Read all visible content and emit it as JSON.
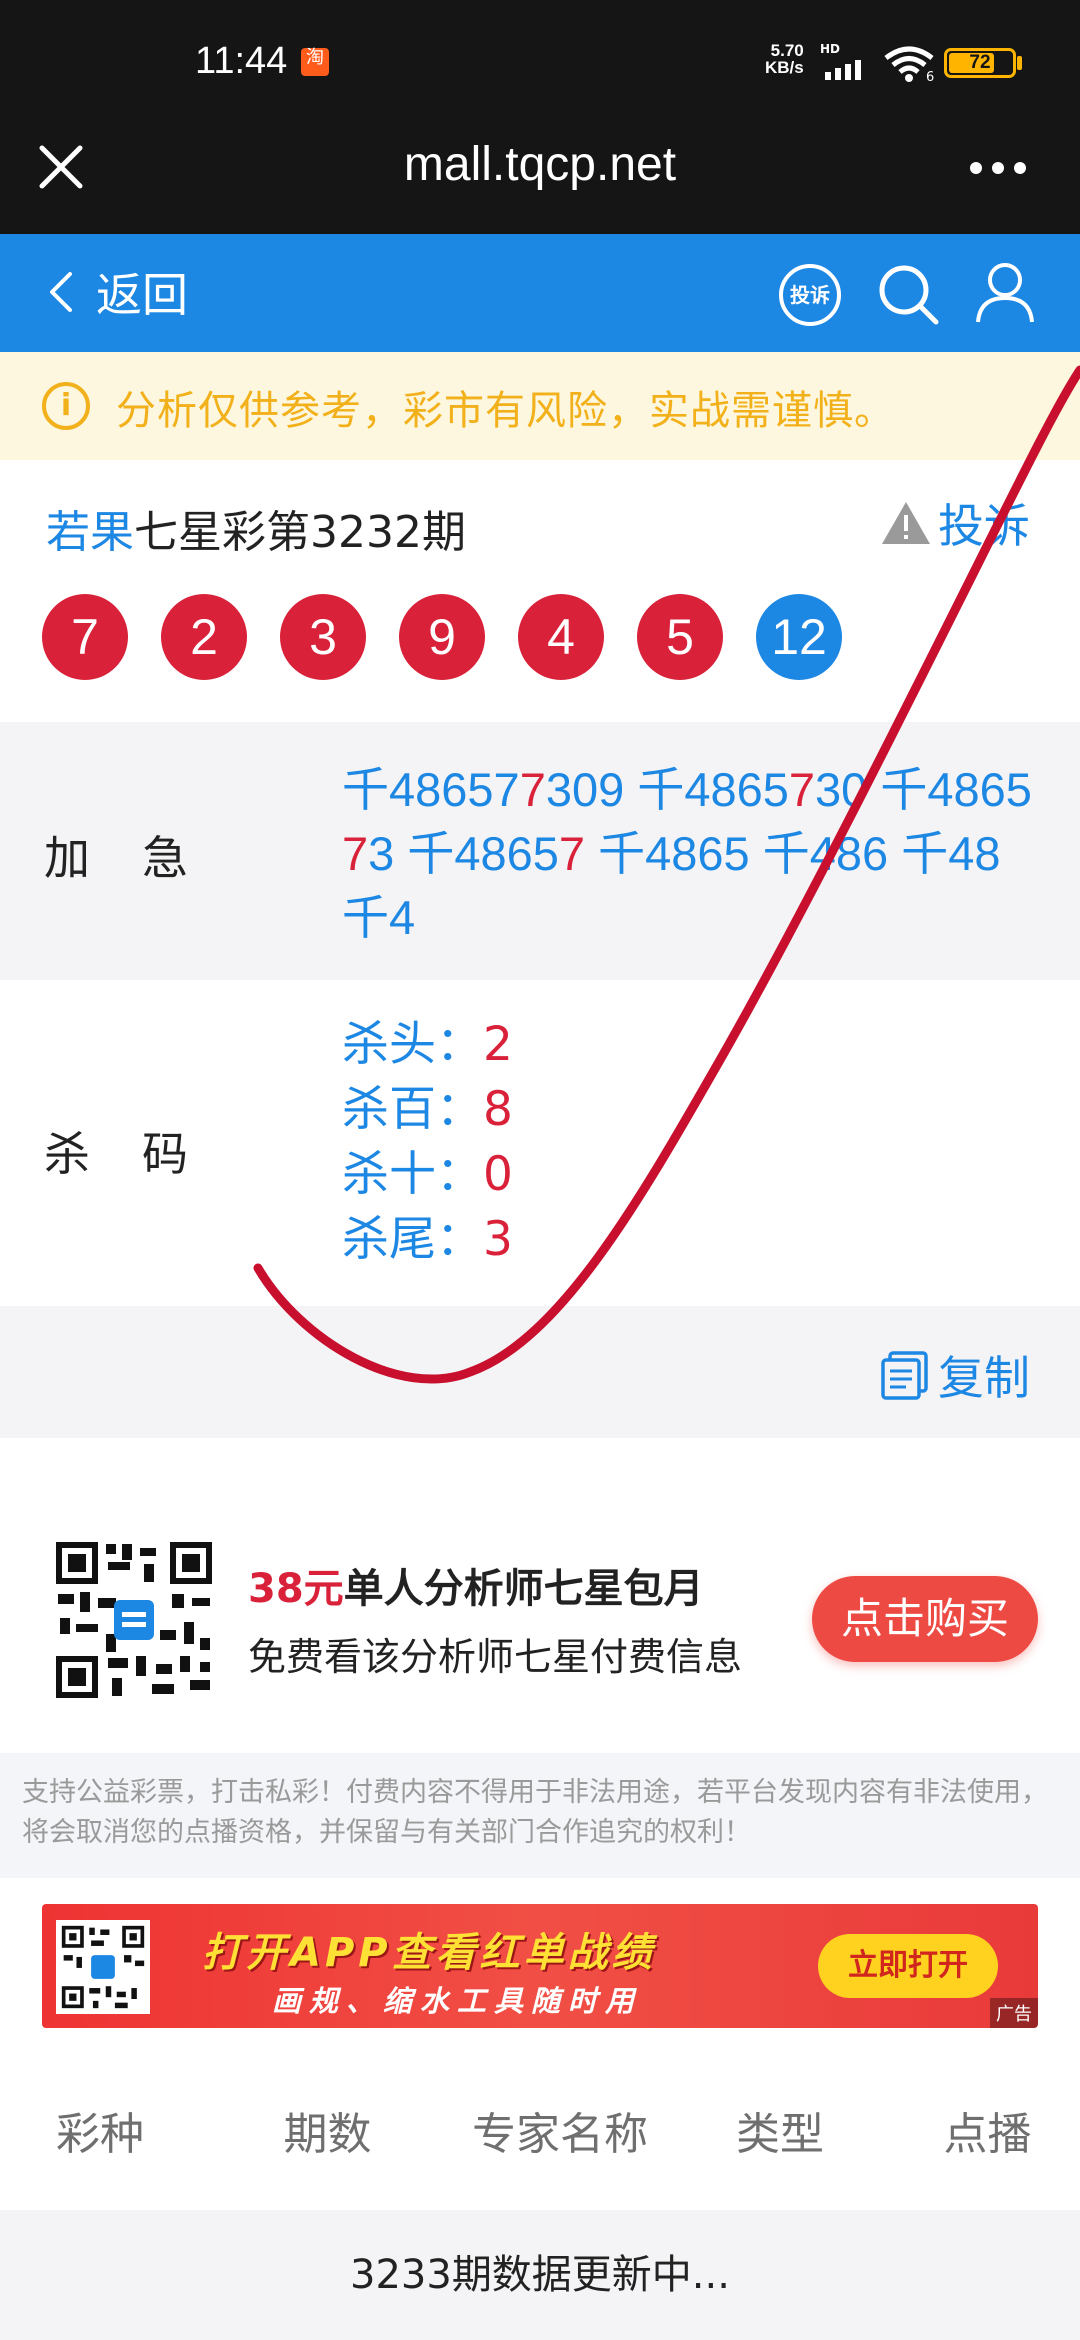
{
  "status_bar": {
    "time": "11:44",
    "notification_badge": "淘",
    "net_speed_value": "5.70",
    "net_speed_unit": "KB/s",
    "hd_label": "HD",
    "wifi_label": "6",
    "battery": "72",
    "battery_level": 0.72
  },
  "browser": {
    "url": "mall.tqcp.net"
  },
  "nav": {
    "back_label": "返回",
    "complain_label": "投诉"
  },
  "notice": {
    "icon": "i",
    "text": "分析仅供参考，彩市有风险，实战需谨慎。"
  },
  "draw": {
    "author": "若果",
    "title": "七星彩第3232期",
    "report_label": "投诉",
    "balls": [
      {
        "value": "7",
        "color": "#d9213a"
      },
      {
        "value": "2",
        "color": "#d9213a"
      },
      {
        "value": "3",
        "color": "#d9213a"
      },
      {
        "value": "9",
        "color": "#d9213a"
      },
      {
        "value": "4",
        "color": "#d9213a"
      },
      {
        "value": "5",
        "color": "#d9213a"
      },
      {
        "value": "12",
        "color": "#1d87e4"
      }
    ]
  },
  "jiaji": {
    "label": "加急",
    "segments": [
      {
        "text": "千48657",
        "hit": false
      },
      {
        "text": "7",
        "hit": true
      },
      {
        "text": "309 千4865",
        "hit": false
      },
      {
        "text": "7",
        "hit": true
      },
      {
        "text": "30 千486",
        "hit": false
      },
      {
        "text": "5",
        "hit": false
      },
      {
        "text": "7",
        "hit": true
      },
      {
        "text": "3 千4865",
        "hit": false
      },
      {
        "text": "7",
        "hit": true
      },
      {
        "text": " 千4865 千486 千48 千4",
        "hit": false
      }
    ]
  },
  "shama": {
    "label": "杀码",
    "items": [
      {
        "key": "杀头：",
        "value": "2"
      },
      {
        "key": "杀百：",
        "value": "8"
      },
      {
        "key": "杀十：",
        "value": "0"
      },
      {
        "key": "杀尾：",
        "value": "3"
      }
    ]
  },
  "copy": {
    "label": "复制"
  },
  "promo": {
    "price": "38元",
    "title": "单人分析师七星包月",
    "subtitle": "免费看该分析师七星付费信息",
    "button": "点击购买"
  },
  "disclaimer": "支持公益彩票，打击私彩！付费内容不得用于非法用途，若平台发现内容有非法使用，将会取消您的点播资格，并保留与有关部门合作追究的权利！",
  "banner": {
    "headline": "打开APP查看红单战绩",
    "subline": "画规、缩水工具随时用",
    "button": "立即打开",
    "ad_tag": "广告"
  },
  "table": {
    "headers": [
      "彩种",
      "期数",
      "专家名称",
      "类型",
      "点播"
    ],
    "empty_text": "3233期数据更新中..."
  },
  "colors": {
    "brand_blue": "#1d87e4",
    "accent_red": "#d9213a",
    "notice_yellow": "#f2b11a"
  }
}
